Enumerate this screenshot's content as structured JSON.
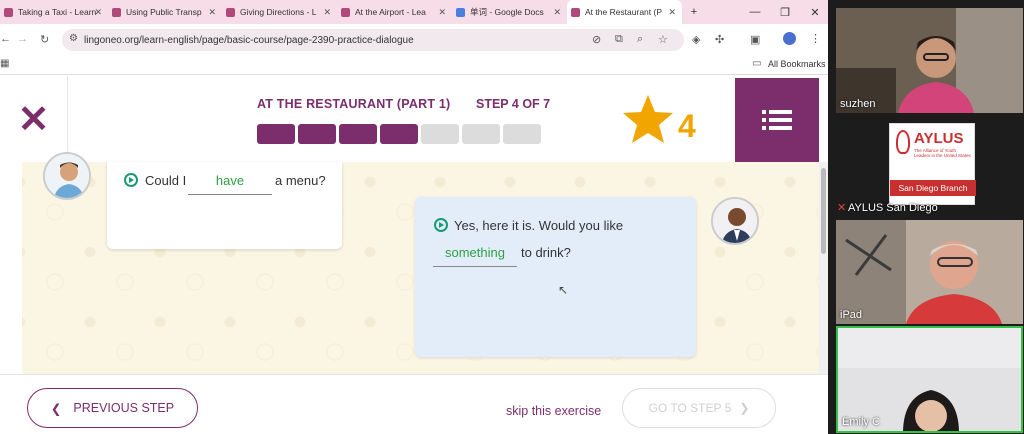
{
  "browser": {
    "tabs": [
      {
        "label": "Taking a Taxi - Learn",
        "icon": "lingoneo-icon"
      },
      {
        "label": "Using Public Transp",
        "icon": "lingoneo-icon"
      },
      {
        "label": "Giving Directions - L",
        "icon": "lingoneo-icon"
      },
      {
        "label": "At the Airport - Lea",
        "icon": "lingoneo-icon"
      },
      {
        "label": "单词 - Google Docs",
        "icon": "google-docs-icon"
      },
      {
        "label": "At the Restaurant (P",
        "icon": "lingoneo-icon"
      }
    ],
    "url": "lingoneo.org/learn-english/page/basic-course/page-2390-practice-dialogue",
    "bookmarks_label": "All Bookmarks"
  },
  "lesson": {
    "title": "AT THE RESTAURANT (PART 1)",
    "step_label": "STEP 4 OF 7",
    "progress": {
      "completed": 4,
      "total": 7
    },
    "stars": "4"
  },
  "dialogue": [
    {
      "speaker": "man-avatar",
      "before": "Could I",
      "blank": "have",
      "after": "a menu?"
    },
    {
      "speaker": "waiter-avatar",
      "line1": "Yes, here it is. Would you like",
      "blank": "something",
      "after": "to drink?"
    }
  ],
  "footer": {
    "prev_label": "PREVIOUS STEP",
    "skip_label": "skip this exercise",
    "next_label": "GO TO STEP 5"
  },
  "video_call": {
    "participants": [
      {
        "name": "suzhen"
      },
      {
        "name": "AYLUS San Diego",
        "muted": true,
        "logo_text": "AYLUS",
        "logo_tagline": "The Alliance of Youth Leaders in the United States",
        "logo_branch": "San Diego Branch"
      },
      {
        "name": "iPad"
      },
      {
        "name": "Emily C",
        "active_speaker": true
      }
    ]
  },
  "colors": {
    "brand": "#7b2d6c",
    "accent_green": "#2e9f47",
    "star": "#f0a500",
    "tab_bar": "#f7dde7"
  }
}
